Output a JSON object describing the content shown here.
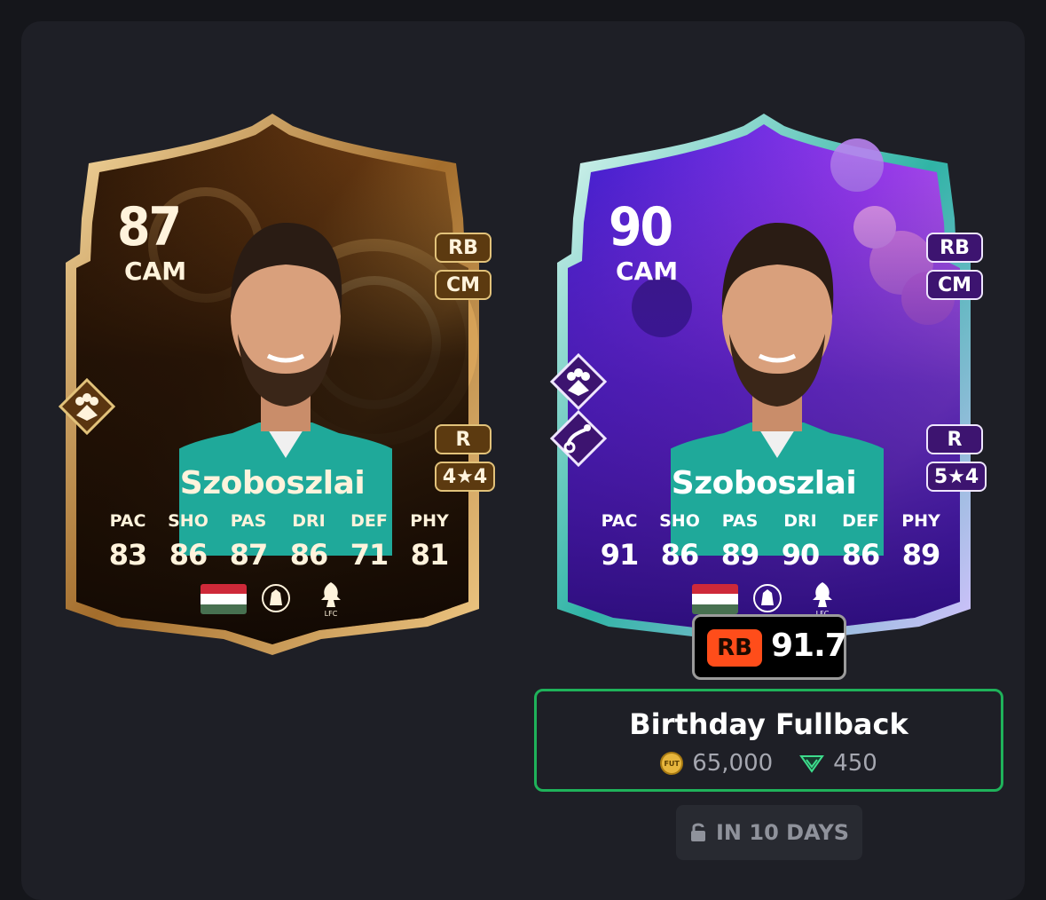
{
  "colors": {
    "page_bg": "#15161b",
    "panel_bg": "#1e1f26",
    "objective_border": "#1fb25a",
    "rb_tag": "#ff4d1a"
  },
  "cards": [
    {
      "theme": "gold",
      "rating": "87",
      "position": "CAM",
      "alt_positions": [
        "RB",
        "CM"
      ],
      "preferred_foot": "R",
      "skills_weakfoot": "4★4",
      "playstyle_icons": [
        "team-player-playstyle-icon"
      ],
      "name": "Szoboszlai",
      "stat_labels": [
        "PAC",
        "SHO",
        "PAS",
        "DRI",
        "DEF",
        "PHY"
      ],
      "stat_values": [
        "83",
        "86",
        "87",
        "86",
        "71",
        "81"
      ],
      "nation": "hungary-flag",
      "league": "premier-league-logo",
      "club": "liverpool-fc-logo",
      "club_text": "LFC"
    },
    {
      "theme": "purple",
      "rating": "90",
      "position": "CAM",
      "alt_positions": [
        "RB",
        "CM"
      ],
      "preferred_foot": "R",
      "skills_weakfoot": "5★4",
      "playstyle_icons": [
        "team-player-playstyle-icon",
        "whipped-pass-playstyle-icon"
      ],
      "name": "Szoboszlai",
      "stat_labels": [
        "PAC",
        "SHO",
        "PAS",
        "DRI",
        "DEF",
        "PHY"
      ],
      "stat_values": [
        "91",
        "86",
        "89",
        "90",
        "86",
        "89"
      ],
      "nation": "hungary-flag",
      "league": "premier-league-logo",
      "club": "liverpool-fc-logo",
      "club_text": "LFC"
    }
  ],
  "position_rating": {
    "position": "RB",
    "value": "91.7"
  },
  "objective": {
    "title": "Birthday Fullback",
    "coins_label": "FUT",
    "coins": "65,000",
    "points": "450"
  },
  "lock_button": {
    "label": "IN 10 DAYS"
  }
}
